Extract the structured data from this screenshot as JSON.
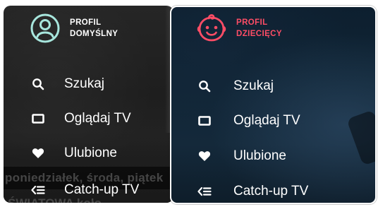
{
  "profiles": [
    {
      "name_line1": "PROFIL",
      "name_line2": "DOMYŚLNY",
      "icon": "user-circle-icon",
      "accent": "#ffffff",
      "icon_color": "#a7e6dd"
    },
    {
      "name_line1": "PROFIL",
      "name_line2": "DZIECIĘCY",
      "icon": "child-face-icon",
      "accent": "#ff4d66",
      "icon_color": "#ff4d66"
    }
  ],
  "menu": [
    {
      "label": "Szukaj",
      "icon": "search-icon"
    },
    {
      "label": "Oglądaj TV",
      "icon": "tv-icon"
    },
    {
      "label": "Ulubione",
      "icon": "heart-icon"
    },
    {
      "label": "Catch-up TV",
      "icon": "catchup-icon"
    }
  ],
  "background": {
    "left_text": "poniedziałek, środa, piątek",
    "left_title": "ŚWIATOWA koło"
  },
  "colors": {
    "left_bg": "#222222",
    "right_bg": "#102535",
    "text": "#ffffff"
  }
}
